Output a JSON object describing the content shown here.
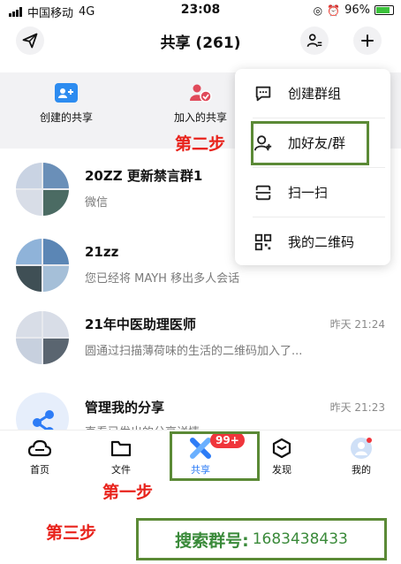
{
  "status_bar": {
    "carrier": "中国移动",
    "network": "4G",
    "time": "23:08",
    "battery": "96%"
  },
  "header": {
    "title": "共享 (261)"
  },
  "quick_actions": [
    {
      "label": "创建的共享"
    },
    {
      "label": "加入的共享"
    }
  ],
  "popup_menu": [
    {
      "label": "创建群组",
      "icon": "chat-bubble-icon"
    },
    {
      "label": "加好友/群",
      "icon": "add-person-icon"
    },
    {
      "label": "扫一扫",
      "icon": "scan-icon"
    },
    {
      "label": "我的二维码",
      "icon": "qr-code-icon"
    }
  ],
  "share_list": [
    {
      "name": "20ZZ 更新禁言群1",
      "subtitle": "微信",
      "time": ""
    },
    {
      "name": "21zz",
      "subtitle": "您已经将 MAYH 移出多人会话",
      "time": ""
    },
    {
      "name": "21年中医助理医师",
      "subtitle": "圆通过扫描薄荷味的生活的二维码加入了...",
      "time": "昨天 21:24"
    },
    {
      "name": "管理我的分享",
      "subtitle": "直看已发出的分享详情",
      "time": "昨天 21:23"
    }
  ],
  "tabs": [
    {
      "label": "首页",
      "icon": "cloud-icon"
    },
    {
      "label": "文件",
      "icon": "folder-icon"
    },
    {
      "label": "共享",
      "icon": "share-x-icon",
      "badge": "99+"
    },
    {
      "label": "发现",
      "icon": "cube-icon"
    },
    {
      "label": "我的",
      "icon": "avatar-icon"
    }
  ],
  "annotations": {
    "step1": "第一步",
    "step2": "第二步",
    "step3": "第三步",
    "search_label": "搜索群号:",
    "search_number": "1683438433"
  },
  "colors": {
    "accent_blue": "#2d7cf6",
    "badge_red": "#f0353b",
    "annotation_red": "#e8231c",
    "annotation_green": "#5b8a36"
  }
}
